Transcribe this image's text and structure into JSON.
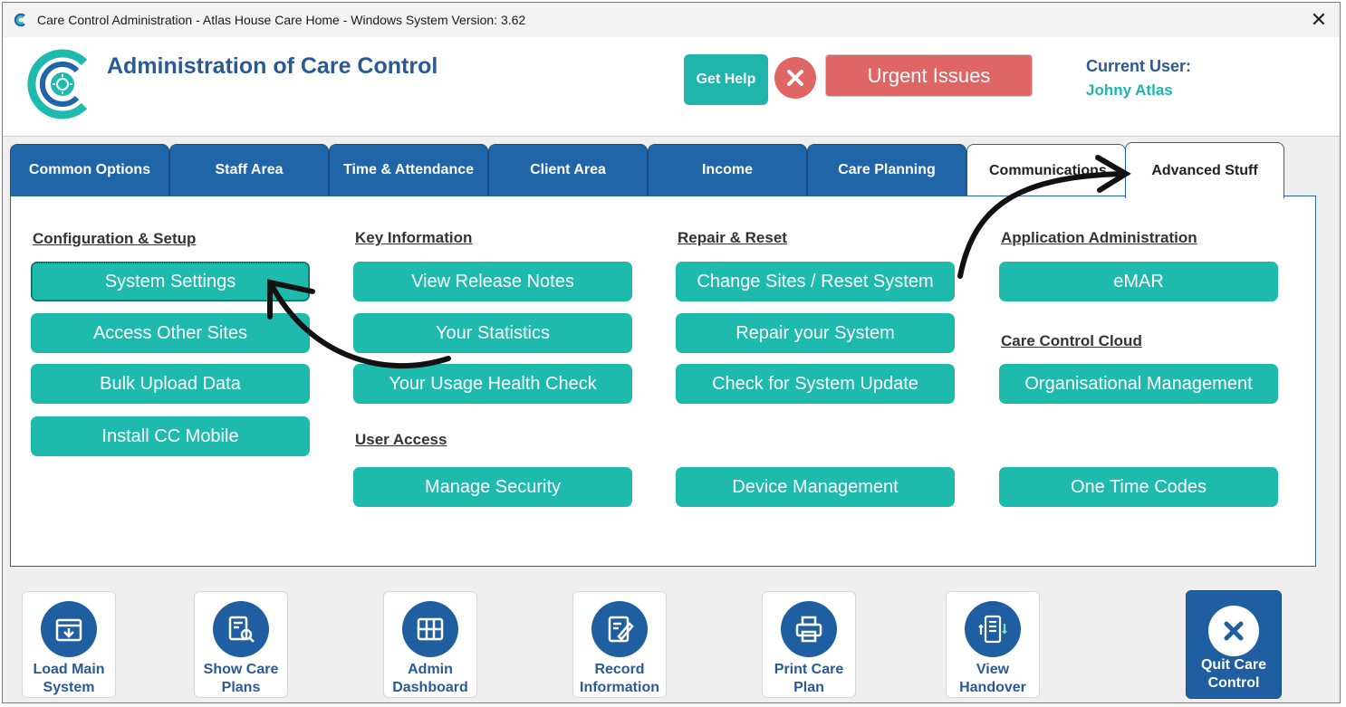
{
  "window": {
    "title": "Care Control Administration - Atlas House Care Home - Windows System Version: 3.62",
    "close_glyph": "✕"
  },
  "header": {
    "app_title": "Administration of Care Control",
    "help_label": "Get Help",
    "urgent_label": "Urgent Issues",
    "user_label": "Current User:",
    "user_name": "Johny Atlas"
  },
  "tabs": [
    {
      "label": "Common Options"
    },
    {
      "label": "Staff Area"
    },
    {
      "label": "Time & Attendance"
    },
    {
      "label": "Client Area"
    },
    {
      "label": "Income"
    },
    {
      "label": "Care Planning"
    },
    {
      "label": "Communications"
    },
    {
      "label": "Advanced Stuff"
    }
  ],
  "sections": {
    "config": {
      "title": "Configuration & Setup",
      "buttons": [
        "System Settings",
        "Access Other Sites",
        "Bulk Upload Data",
        "Install CC Mobile"
      ]
    },
    "key_info": {
      "title": "Key Information",
      "buttons": [
        "View Release Notes",
        "Your Statistics",
        "Your Usage Health Check"
      ]
    },
    "user_access": {
      "title": "User Access",
      "buttons": [
        "Manage Security"
      ]
    },
    "repair": {
      "title": "Repair & Reset",
      "buttons": [
        "Change Sites / Reset System",
        "Repair your System",
        "Check for System Update",
        "Device Management"
      ]
    },
    "app_admin": {
      "title": "Application Administration",
      "buttons": [
        "eMAR"
      ]
    },
    "cloud": {
      "title": "Care Control Cloud",
      "buttons": [
        "Organisational Management",
        "One Time Codes"
      ]
    }
  },
  "bottom_bar": [
    {
      "line1": "Load Main",
      "line2": "System",
      "icon": "download-box-icon"
    },
    {
      "line1": "Show Care",
      "line2": "Plans",
      "icon": "search-document-icon"
    },
    {
      "line1": "Admin",
      "line2": "Dashboard",
      "icon": "dashboard-grid-icon"
    },
    {
      "line1": "Record",
      "line2": "Information",
      "icon": "edit-document-icon"
    },
    {
      "line1": "Print Care",
      "line2": "Plan",
      "icon": "printer-icon"
    },
    {
      "line1": "View",
      "line2": "Handover",
      "icon": "handover-list-icon"
    }
  ],
  "quit": {
    "line1": "Quit Care",
    "line2": "Control",
    "icon": "close-circle-icon"
  },
  "colors": {
    "teal": "#1fbaae",
    "navy": "#1f65a8",
    "urgent_red": "#e06666",
    "title_blue": "#2a5a94"
  }
}
